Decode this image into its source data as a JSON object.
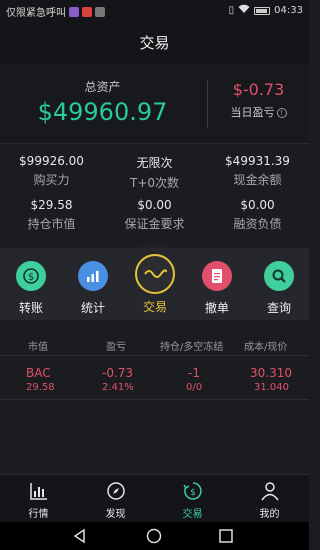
{
  "status_bar": {
    "carrier": "仅限紧急呼叫",
    "time": "04:33",
    "icons": [
      "vibrate-icon",
      "wifi-icon",
      "battery-icon"
    ]
  },
  "header": {
    "title": "交易"
  },
  "summary": {
    "total_assets_label": "总资产",
    "total_assets_value": "$49960.97",
    "daily_pnl_value": "$-0.73",
    "daily_pnl_label": "当日盈亏"
  },
  "metrics": [
    {
      "value": "$99926.00",
      "label": "购买力"
    },
    {
      "value": "无限次",
      "label": "T+0次数"
    },
    {
      "value": "$49931.39",
      "label": "现金余额"
    },
    {
      "value": "$29.58",
      "label": "持仓市值"
    },
    {
      "value": "$0.00",
      "label": "保证金要求"
    },
    {
      "value": "$0.00",
      "label": "融资负债"
    }
  ],
  "actions": [
    {
      "label": "转账",
      "icon": "dollar-transfer-icon",
      "color": "#3fcf9c"
    },
    {
      "label": "统计",
      "icon": "chart-icon",
      "color": "#4a90e2"
    },
    {
      "label": "交易",
      "icon": "trade-wave-icon",
      "color": "#e8c43a"
    },
    {
      "label": "撤单",
      "icon": "document-icon",
      "color": "#e0506a"
    },
    {
      "label": "查询",
      "icon": "search-icon",
      "color": "#3fcf9c"
    }
  ],
  "positions": {
    "columns": [
      "市值",
      "盈亏",
      "持仓/多空冻结",
      "成本/现价"
    ],
    "rows": [
      {
        "symbol": "BAC",
        "market_value": "29.58",
        "pnl": "-0.73",
        "pnl_pct": "2.41%",
        "position": "-1",
        "frozen": "0/0",
        "cost": "30.310",
        "price": "31.040"
      }
    ]
  },
  "tabs": [
    {
      "label": "行情",
      "icon": "market-chart-icon"
    },
    {
      "label": "发现",
      "icon": "compass-icon"
    },
    {
      "label": "交易",
      "icon": "trade-dollar-icon",
      "active": true
    },
    {
      "label": "我的",
      "icon": "profile-icon"
    }
  ],
  "colors": {
    "accent_green": "#3fcf9c",
    "loss_red": "#e0506a",
    "gold": "#e8c43a"
  }
}
